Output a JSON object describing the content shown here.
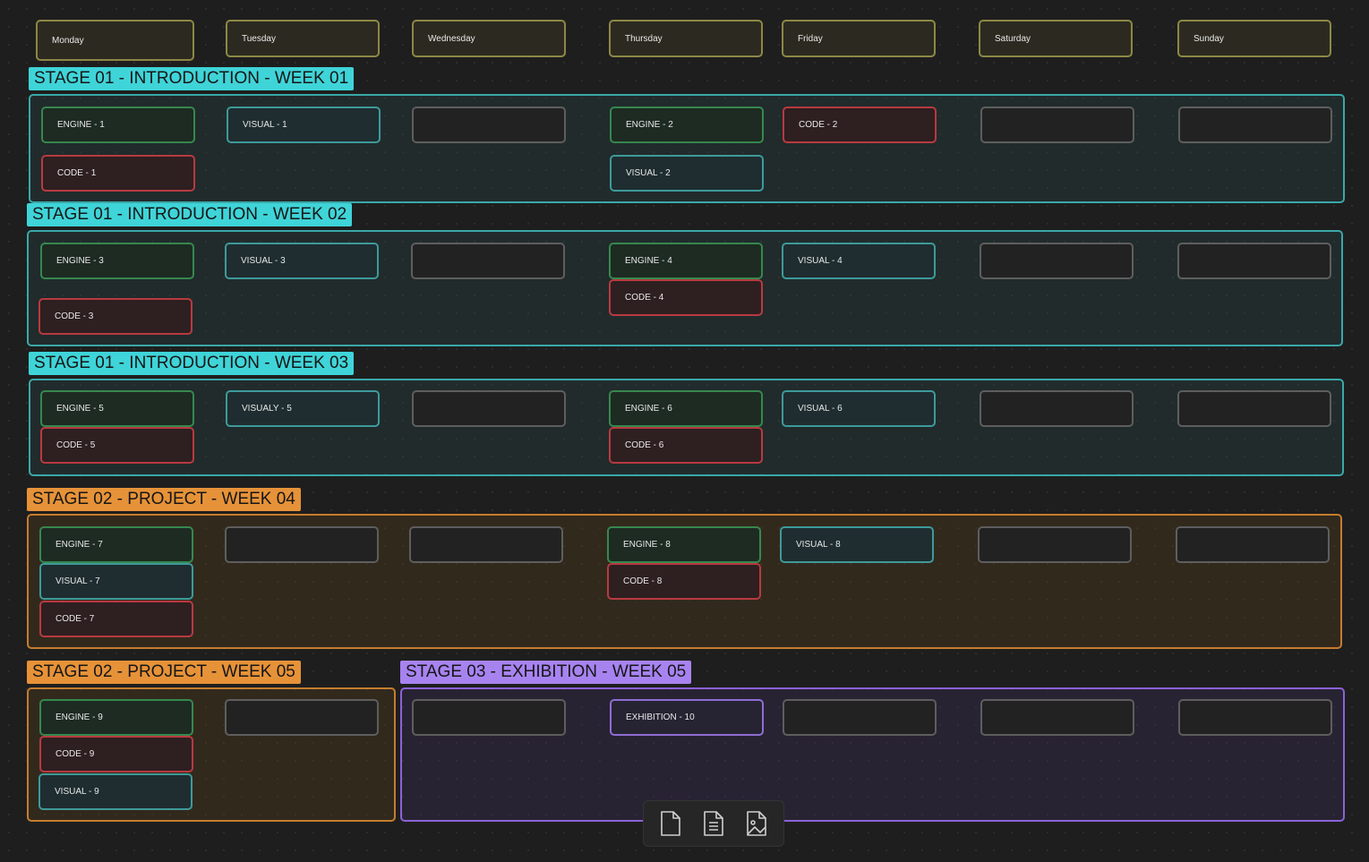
{
  "days": [
    "Monday",
    "Tuesday",
    "Wednesday",
    "Thursday",
    "Friday",
    "Saturday",
    "Sunday"
  ],
  "groups": [
    {
      "label": "STAGE 01 - INTRODUCTION - WEEK 01"
    },
    {
      "label": "STAGE 01 - INTRODUCTION - WEEK 02"
    },
    {
      "label": "STAGE 01 - INTRODUCTION - WEEK 03"
    },
    {
      "label": "STAGE 02 - PROJECT - WEEK 04"
    },
    {
      "label": "STAGE 02 - PROJECT - WEEK 05"
    },
    {
      "label": "STAGE 03 - EXHIBITION - WEEK 05"
    }
  ],
  "cards": {
    "w1": {
      "engine1": "ENGINE - 1",
      "visual1": "VISUAL - 1",
      "engine2": "ENGINE - 2",
      "code2": "CODE - 2",
      "code1": "CODE - 1",
      "visual2": "VISUAL - 2"
    },
    "w2": {
      "engine3": "ENGINE - 3",
      "visual3": "VISUAL - 3",
      "engine4": "ENGINE - 4",
      "visual4": "VISUAL - 4",
      "code4": "CODE - 4",
      "code3": "CODE - 3"
    },
    "w3": {
      "engine5": "ENGINE - 5",
      "visual5": "VISUALY - 5",
      "engine6": "ENGINE - 6",
      "visual6": "VISUAL - 6",
      "code5": "CODE - 5",
      "code6": "CODE - 6"
    },
    "w4": {
      "engine7": "ENGINE - 7",
      "engine8": "ENGINE - 8",
      "visual8": "VISUAL - 8",
      "visual7": "VISUAL - 7",
      "code8": "CODE - 8",
      "code7": "CODE - 7"
    },
    "w5": {
      "engine9": "ENGINE - 9",
      "code9": "CODE - 9",
      "visual9": "VISUAL - 9",
      "exhibition10": "EXHIBITION - 10"
    }
  },
  "toolbar": {
    "icons": [
      "new-note-icon",
      "text-file-icon",
      "image-file-icon"
    ]
  },
  "colors": {
    "stage01": "#3fd4d8",
    "stage02": "#e69238",
    "stage03": "#a783f0",
    "engine": "#36884e",
    "visual": "#3e9a9a",
    "code": "#b83a40"
  }
}
